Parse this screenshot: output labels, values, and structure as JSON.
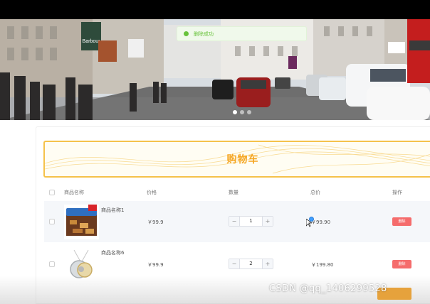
{
  "toast": {
    "message": "删除成功"
  },
  "banner": {
    "shop_sign": "Barbour",
    "bus_text": "",
    "slides": 3,
    "active_slide": 1
  },
  "cart": {
    "title": "购物车"
  },
  "table": {
    "headers": {
      "name": "商品名称",
      "price": "价格",
      "quantity": "数量",
      "total": "总价",
      "action": "操作"
    },
    "rows": [
      {
        "name": "商品名称1",
        "price": "￥99.9",
        "quantity": "1",
        "total": "￥99.90",
        "action": "删除",
        "image": "snack-box-image"
      },
      {
        "name": "商品名称6",
        "price": "￥99.9",
        "quantity": "2",
        "total": "￥199.80",
        "action": "删除",
        "image": "pendant-necklace-image"
      }
    ],
    "minus_symbol": "−",
    "plus_symbol": "+"
  },
  "watermark": "CSDN @qq_1406299528",
  "colors": {
    "accent": "#f5a623",
    "success": "#67c23a",
    "danger": "#f56c6c"
  }
}
